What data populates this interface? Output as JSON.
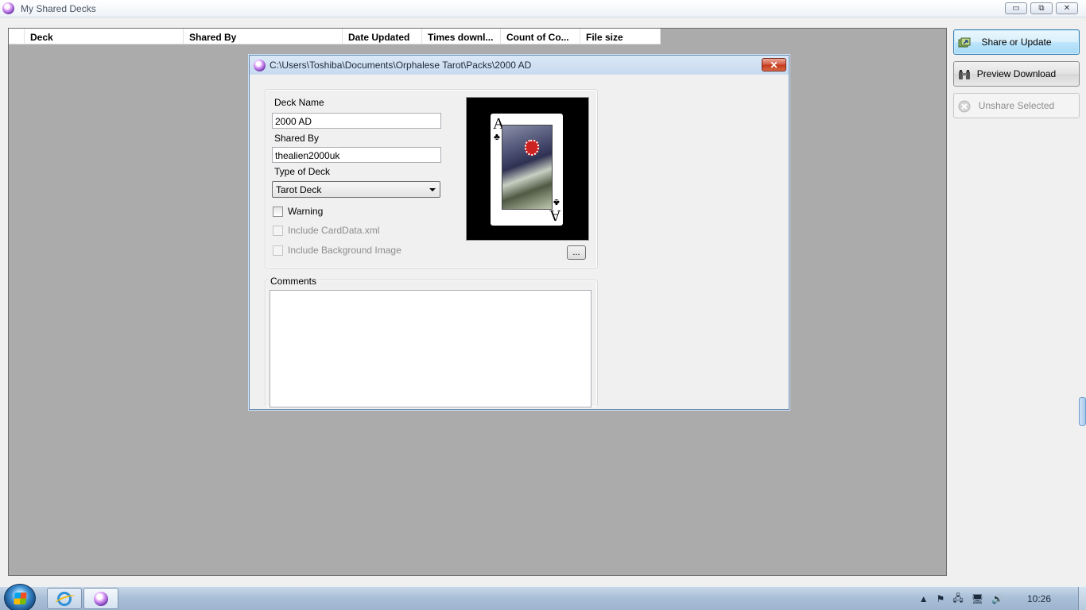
{
  "window": {
    "title": "My Shared Decks",
    "controls": {
      "minimize": "▭",
      "restore": "⧉",
      "close": "✕"
    }
  },
  "grid": {
    "columns": [
      "Deck",
      "Shared By",
      "Date Updated",
      "Times downl...",
      "Count of Co...",
      "File size"
    ]
  },
  "side_buttons": {
    "share": "Share or Update",
    "preview": "Preview Download",
    "unshare": "Unshare Selected"
  },
  "dialog": {
    "title": "C:\\Users\\Toshiba\\Documents\\Orphalese Tarot\\Packs\\2000 AD",
    "close": "✕",
    "deck_name_label": "Deck Name",
    "deck_name_value": "2000 AD",
    "shared_by_label": "Shared By",
    "shared_by_value": "thealien2000uk",
    "type_label": "Type of Deck",
    "type_value": "Tarot Deck",
    "warning_label": "Warning",
    "include_carddata_label": "Include CardData.xml",
    "include_bg_label": "Include Background Image",
    "browse_button": "...",
    "comments_label": "Comments",
    "card": {
      "rank": "A",
      "suit": "♣"
    }
  },
  "taskbar": {
    "clock": "10:26",
    "tray_icons": [
      "▲",
      "⚑",
      "🖧",
      "🖥",
      "🔊"
    ]
  },
  "colors": {
    "grid_bg": "#ababab",
    "accent": "#3c7fb1",
    "close_red": "#c23619"
  }
}
